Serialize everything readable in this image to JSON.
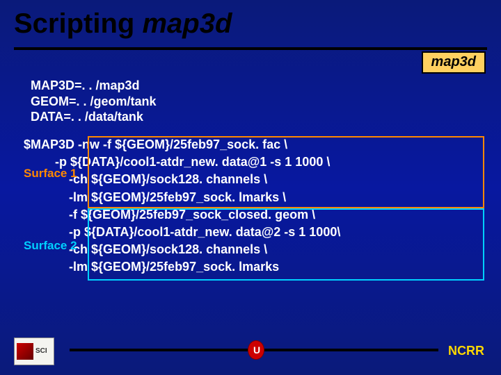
{
  "title": {
    "plain": "Scripting ",
    "ital": "map3d"
  },
  "badge": "map3d",
  "env": "MAP3D=. . /map3d\nGEOM=. . /geom/tank\nDATA=. . /data/tank",
  "code": "$MAP3D -nw -f ${GEOM}/25feb97_sock. fac \\\n         -p ${DATA}/cool1-atdr_new. data@1 -s 1 1000 \\\n             -ch ${GEOM}/sock128. channels \\\n             -lm ${GEOM}/25feb97_sock. lmarks \\\n             -f ${GEOM}/25feb97_sock_closed. geom \\\n             -p ${DATA}/cool1-atdr_new. data@2 -s 1 1000\\\n             -ch ${GEOM}/sock128. channels \\\n             -lm ${GEOM}/25feb97_sock. lmarks",
  "surf1": "Surface 1",
  "surf2": "Surface 2",
  "ncrr": "NCRR",
  "sci": "SCI",
  "oval": "U"
}
